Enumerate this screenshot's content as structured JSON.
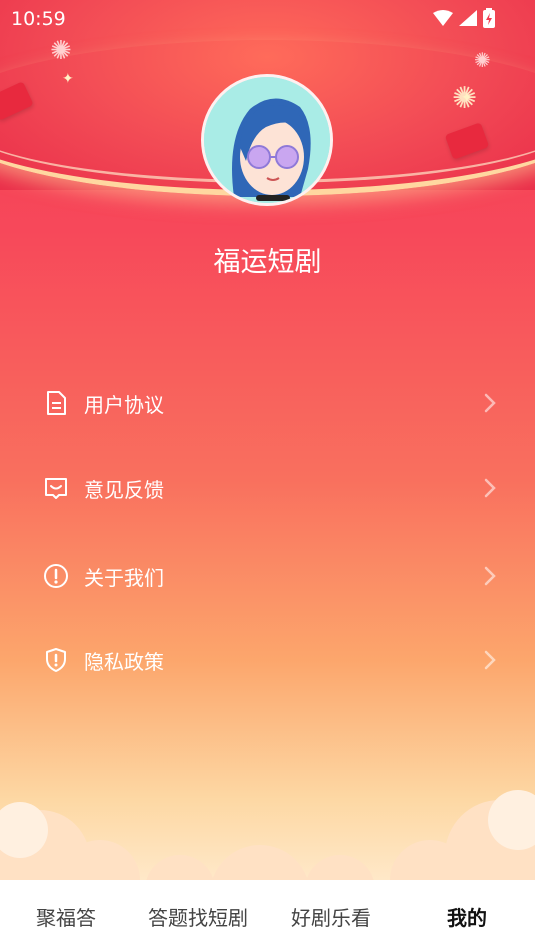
{
  "status_bar": {
    "time": "10:59"
  },
  "profile": {
    "name": "福运短剧"
  },
  "menu": [
    {
      "label": "用户协议",
      "icon": "document-icon"
    },
    {
      "label": "意见反馈",
      "icon": "feedback-icon"
    },
    {
      "label": "关于我们",
      "icon": "info-icon"
    },
    {
      "label": "隐私政策",
      "icon": "shield-icon"
    }
  ],
  "tabs": [
    {
      "label": "聚福答",
      "active": false
    },
    {
      "label": "答题找短剧",
      "active": false
    },
    {
      "label": "好剧乐看",
      "active": false
    },
    {
      "label": "我的",
      "active": true
    }
  ],
  "colors": {
    "accent": "#f33c52",
    "text_on_accent": "#ffffff",
    "tab_active": "#111111",
    "tab_inactive": "#444444"
  }
}
